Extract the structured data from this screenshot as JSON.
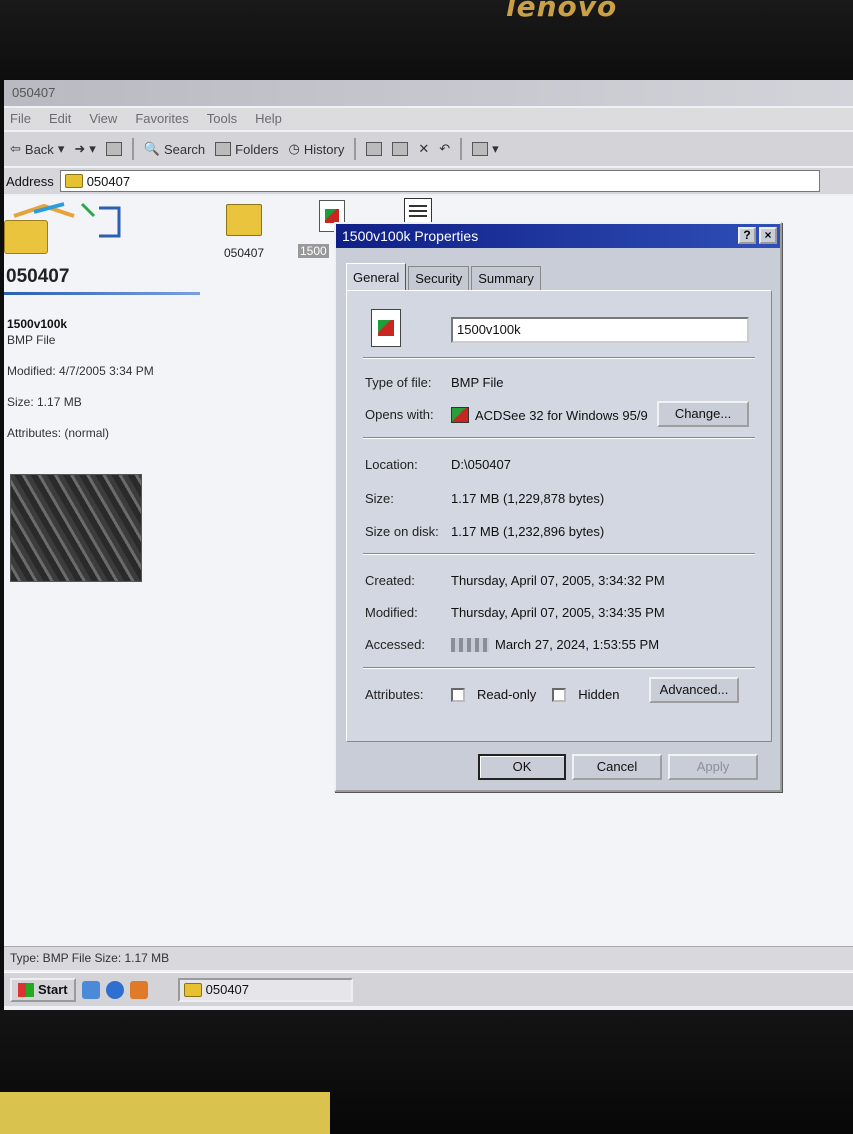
{
  "monitor": {
    "brand": "lenovo"
  },
  "window": {
    "title": "050407"
  },
  "menu": [
    "File",
    "Edit",
    "View",
    "Favorites",
    "Tools",
    "Help"
  ],
  "toolbar": {
    "back": "Back",
    "search": "Search",
    "folders": "Folders",
    "history": "History"
  },
  "address": {
    "label": "Address",
    "value": "050407"
  },
  "banner": {
    "title": "050407"
  },
  "selection_info": {
    "name": "1500v100k",
    "type": "BMP File",
    "modified": "Modified: 4/7/2005 3:34 PM",
    "size": "Size: 1.17 MB",
    "attributes": "Attributes: (normal)"
  },
  "files": [
    {
      "label": "050407",
      "icon": "folder-shortcut-icon"
    },
    {
      "label": "1500",
      "icon": "bmp-file-icon"
    },
    {
      "label": "",
      "icon": "document-icon"
    }
  ],
  "status": {
    "text": "Type: BMP File Size: 1.17 MB"
  },
  "taskbar": {
    "start": "Start",
    "task": "050407"
  },
  "dialog": {
    "title": "1500v100k Properties",
    "tabs": [
      "General",
      "Security",
      "Summary"
    ],
    "filename": "1500v100k",
    "type_label": "Type of file:",
    "type_value": "BMP File",
    "opens_label": "Opens with:",
    "opens_value": "ACDSee 32 for Windows 95/9",
    "change_button": "Change...",
    "location_label": "Location:",
    "location_value": "D:\\050407",
    "size_label": "Size:",
    "size_value": "1.17 MB (1,229,878 bytes)",
    "disk_label": "Size on disk:",
    "disk_value": "1.17 MB (1,232,896 bytes)",
    "created_label": "Created:",
    "created_value": "Thursday, April 07, 2005, 3:34:32 PM",
    "modified_label": "Modified:",
    "modified_value": "Thursday, April 07, 2005, 3:34:35 PM",
    "accessed_label": "Accessed:",
    "accessed_value": "March 27, 2024, 1:53:55 PM",
    "attributes_label": "Attributes:",
    "readonly_label": "Read-only",
    "hidden_label": "Hidden",
    "advanced_button": "Advanced...",
    "ok_button": "OK",
    "cancel_button": "Cancel",
    "apply_button": "Apply",
    "help_glyph": "?",
    "close_glyph": "×"
  }
}
